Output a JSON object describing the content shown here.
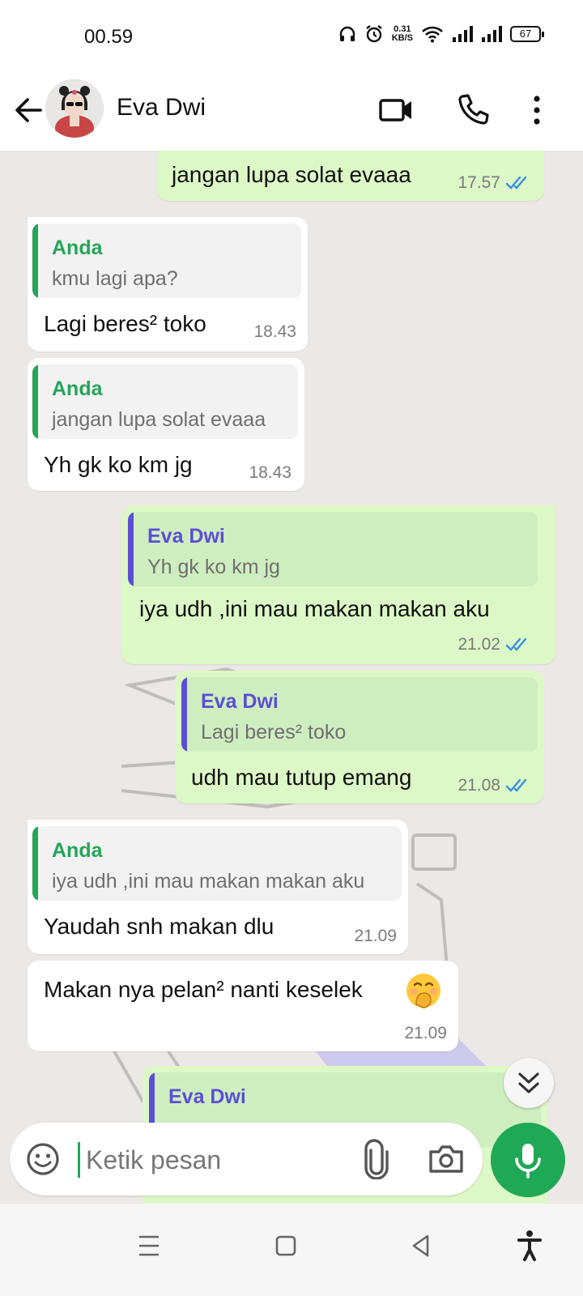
{
  "status_bar": {
    "time": "00.59",
    "net_speed_value": "0.31",
    "net_speed_unit": "KB/S",
    "battery": "67",
    "icons": [
      "headphones-icon",
      "alarm-icon",
      "wifi-icon",
      "signal-icon",
      "signal-icon",
      "battery-icon"
    ]
  },
  "header": {
    "contact_name": "Eva Dwi",
    "icons": [
      "back-arrow-icon",
      "video-call-icon",
      "phone-icon",
      "more-vert-icon"
    ]
  },
  "messages": [
    {
      "direction": "out",
      "text": "jangan lupa solat evaaa",
      "time": "17.57",
      "ticks": "double-check-icon"
    },
    {
      "direction": "in",
      "quote_author": "Anda",
      "quote_text": "kmu lagi apa?",
      "text": "Lagi beres² toko",
      "time": "18.43"
    },
    {
      "direction": "in",
      "quote_author": "Anda",
      "quote_text": "jangan lupa solat evaaa",
      "text": "Yh gk ko km jg",
      "time": "18.43"
    },
    {
      "direction": "out",
      "quote_author": "Eva Dwi",
      "quote_text": "Yh gk ko km jg",
      "text": "iya udh ,ini mau makan makan aku",
      "time": "21.02",
      "ticks": "double-check-icon"
    },
    {
      "direction": "out",
      "quote_author": "Eva Dwi",
      "quote_text": "Lagi beres² toko",
      "text": "udh mau tutup emang",
      "time": "21.08",
      "ticks": "double-check-icon"
    },
    {
      "direction": "in",
      "quote_author": "Anda",
      "quote_text": "iya udh ,ini mau makan makan aku",
      "text": "Yaudah snh makan dlu",
      "time": "21.09"
    },
    {
      "direction": "in",
      "text": "Makan nya pelan² nanti keselek",
      "emoji": "hand-over-mouth-emoji",
      "time": "21.09"
    },
    {
      "direction": "out",
      "quote_author": "Eva Dwi"
    }
  ],
  "composer": {
    "placeholder": "Ketik pesan",
    "icons": [
      "emoji-icon",
      "attach-icon",
      "camera-icon",
      "mic-icon"
    ]
  },
  "colors": {
    "outgoing_bubble": "#dcf8c6",
    "incoming_bubble": "#ffffff",
    "anda_quote": "#25a55a",
    "eva_quote": "#5a4fd6",
    "read_ticks": "#3a8fe0",
    "accent_green": "#1fa855"
  }
}
